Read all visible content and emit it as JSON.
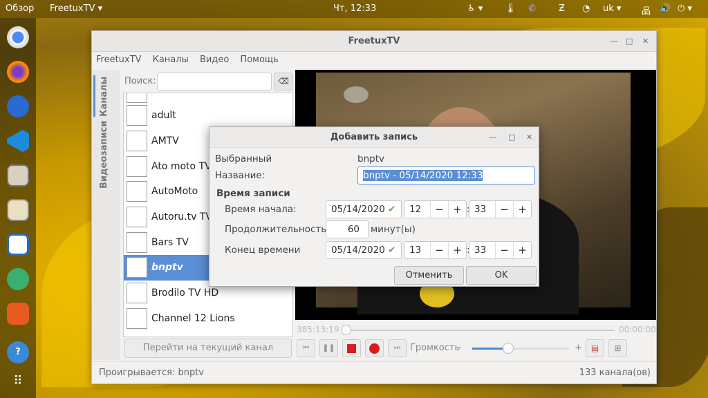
{
  "topbar": {
    "activities": "Обзор",
    "app": "FreetuxTV ▾",
    "clock": "Чт, 12:33",
    "lang": "uk ▾"
  },
  "window": {
    "title": "FreetuxTV",
    "menu": [
      "FreetuxTV",
      "Каналы",
      "Видео",
      "Помощь"
    ],
    "tabs": [
      "Каналы",
      "Видеозаписи"
    ],
    "search_label": "Поиск:",
    "search_value": "",
    "channels": [
      "adult",
      "AMTV",
      "Ato moto TV",
      "AutoMoto",
      "Autoru.tv TV",
      "Bars TV",
      "bnptv",
      "Brodilo TV HD",
      "Channel 12 Lions"
    ],
    "selected_channel": "bnptv",
    "goto_button": "Перейти на текущий канал",
    "time_elapsed": "385:13:19",
    "time_total": "00:00:00",
    "volume_label": "Громкость",
    "volume_minus": "-",
    "volume_plus": "+",
    "volume_percent": 37,
    "status_playing": "Проигрывается: bnptv",
    "status_count": "133 канала(ов)"
  },
  "dialog": {
    "title": "Добавить запись",
    "selected_label": "Выбранный",
    "selected_value": "bnptv",
    "name_label": "Название:",
    "name_value": "bnptv - 05/14/2020 12:33",
    "section": "Время записи",
    "start_label": "Время начала:",
    "start_date": "05/14/2020",
    "start_hour": "12",
    "start_min": "33",
    "duration_label": "Продолжительность",
    "duration_value": "60",
    "duration_unit": "минут(ы)",
    "end_label": "Конец времени",
    "end_date": "05/14/2020",
    "end_hour": "13",
    "end_min": "33",
    "cancel": "Отменить",
    "ok": "OK",
    "minus": "−",
    "plus": "+",
    "colon": ":",
    "check": "✔"
  }
}
